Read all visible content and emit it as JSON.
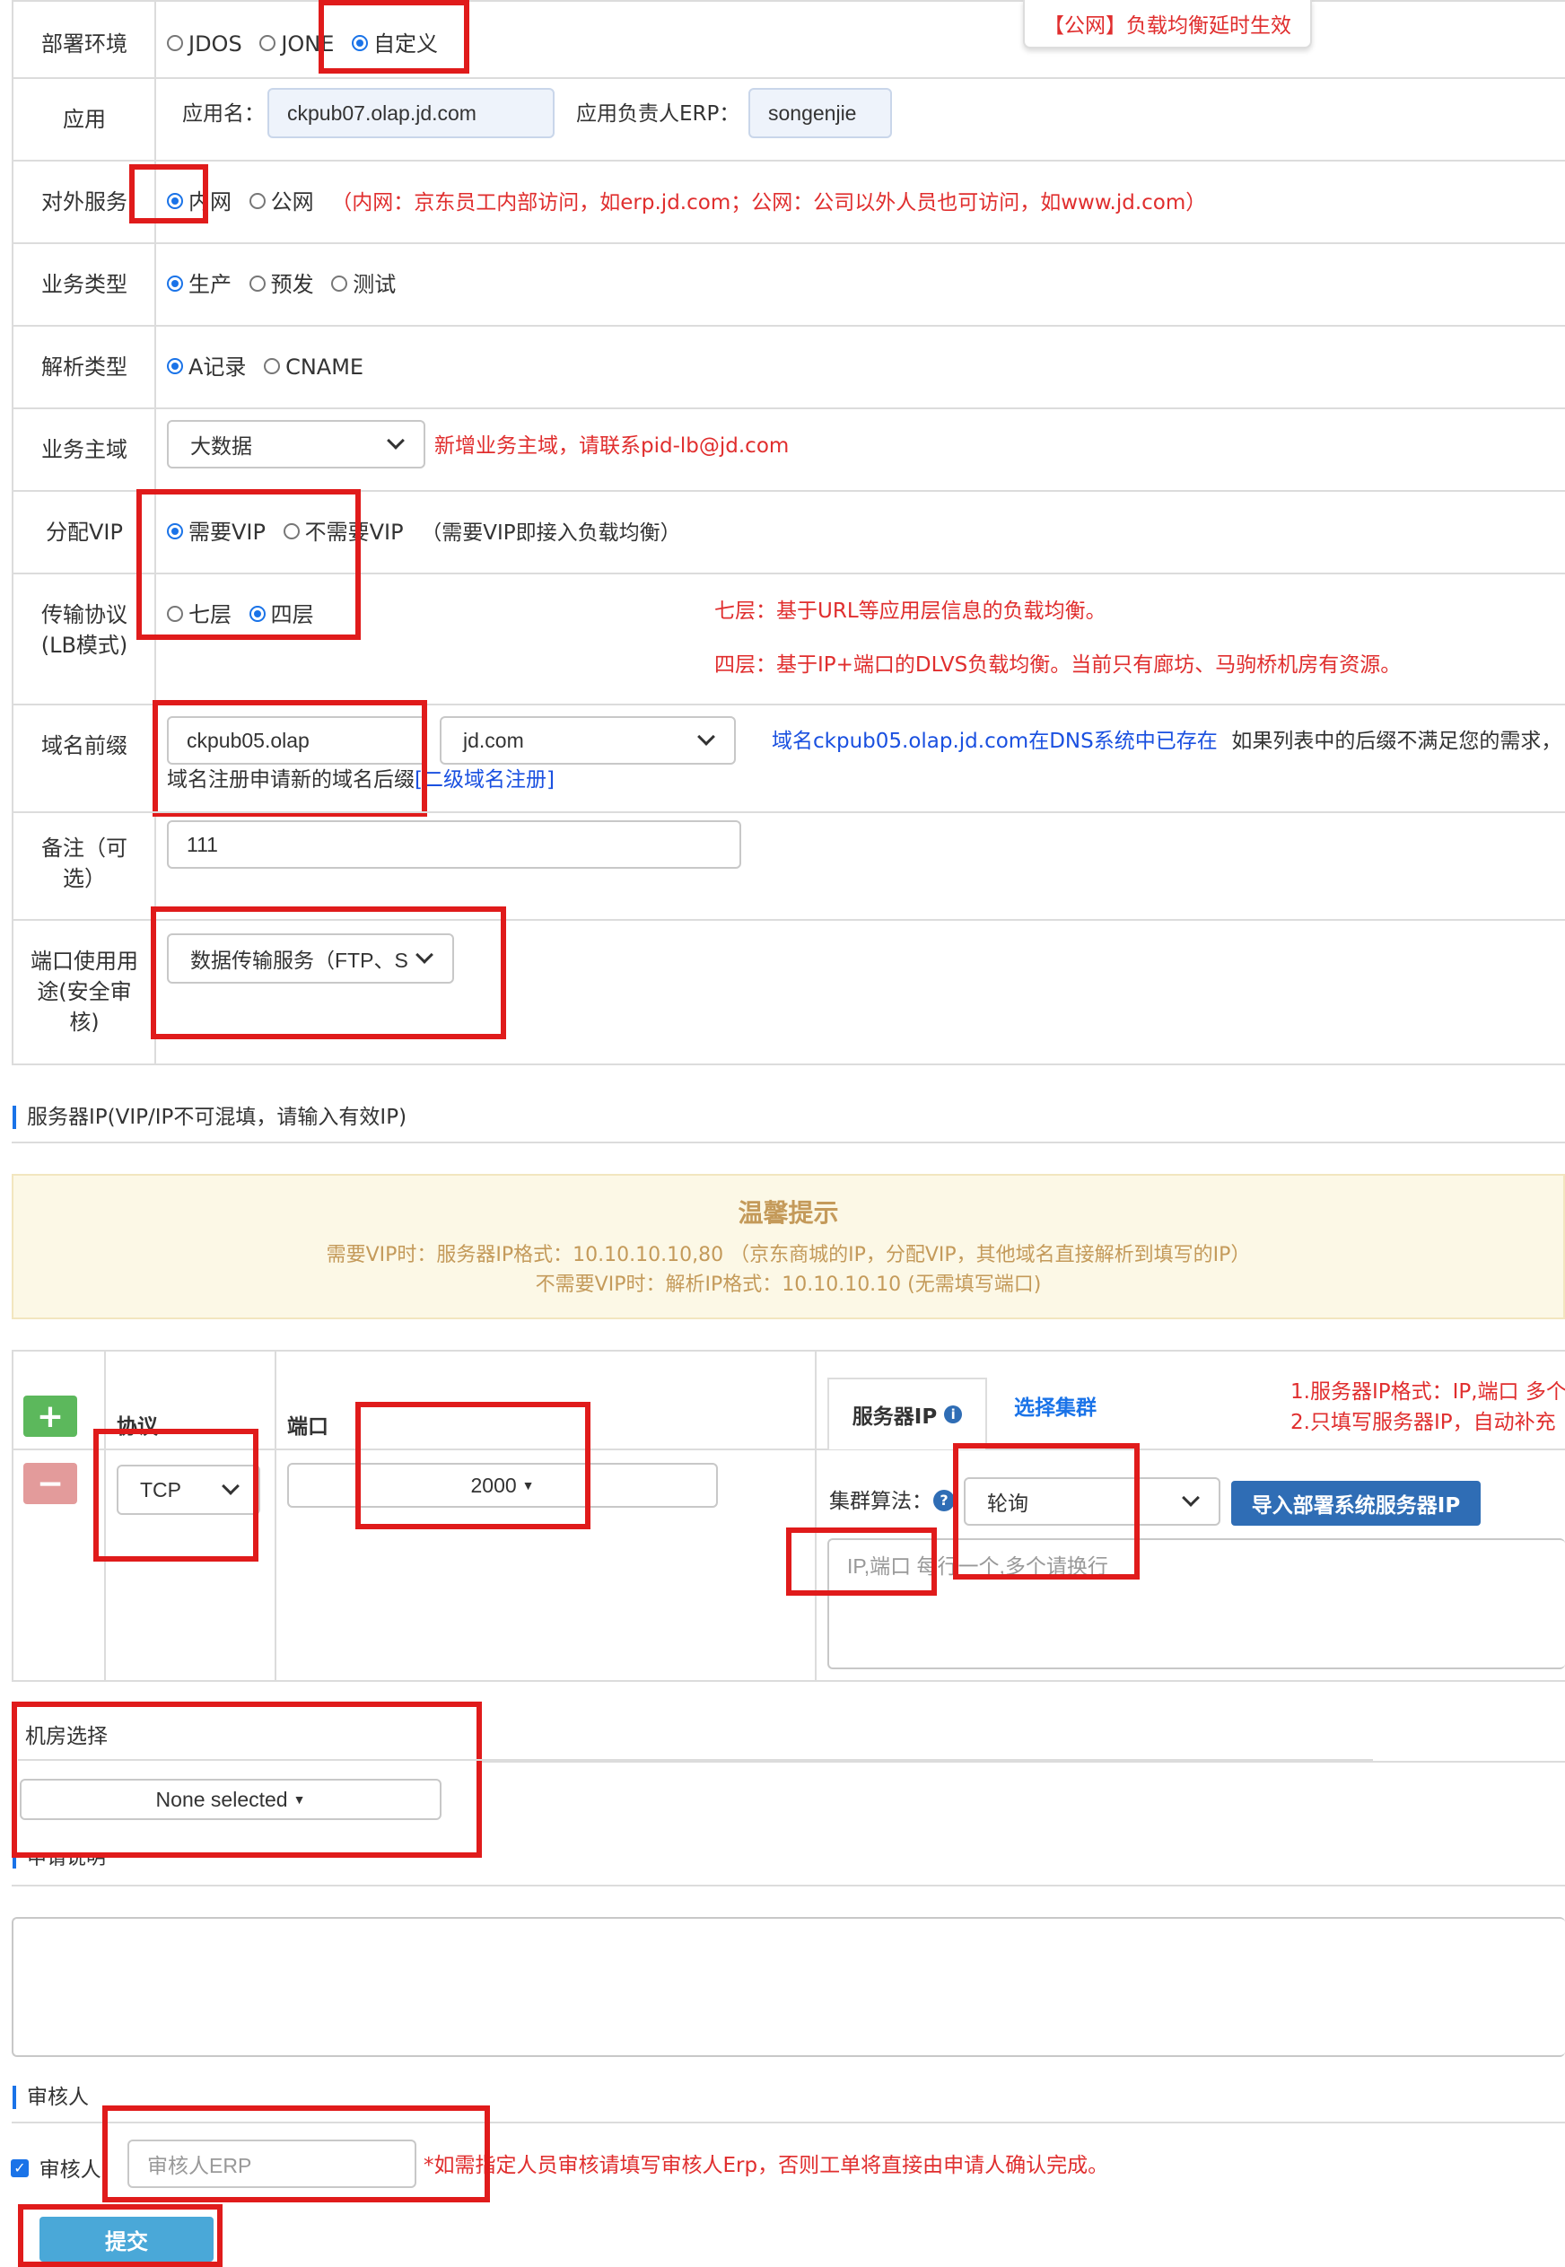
{
  "notice_tooltip": "【公网】负载均衡延时生效",
  "deploy_env": {
    "label": "部署环境",
    "options": [
      "JDOS",
      "JONE",
      "自定义"
    ],
    "selected": "自定义"
  },
  "app": {
    "label": "应用",
    "name_label": "应用名：",
    "name_value": "ckpub07.olap.jd.com",
    "owner_label": "应用负责人ERP：",
    "owner_value": "songenjie"
  },
  "external_service": {
    "label": "对外服务",
    "options": [
      "内网",
      "公网"
    ],
    "selected": "内网",
    "hint": "（内网：京东员工内部访问，如erp.jd.com；公网：公司以外人员也可访问，如www.jd.com）"
  },
  "business_type": {
    "label": "业务类型",
    "options": [
      "生产",
      "预发",
      "测试"
    ],
    "selected": "生产"
  },
  "resolve_type": {
    "label": "解析类型",
    "options": [
      "A记录",
      "CNAME"
    ],
    "selected": "A记录"
  },
  "business_domain": {
    "label": "业务主域",
    "selected": "大数据",
    "hint": "新增业务主域，请联系pid-lb@jd.com"
  },
  "assign_vip": {
    "label": "分配VIP",
    "options": [
      "需要VIP",
      "不需要VIP"
    ],
    "selected": "需要VIP",
    "note": "（需要VIP即接入负载均衡）"
  },
  "transport_protocol": {
    "label_line1": "传输协议",
    "label_line2": "(LB模式)",
    "options": [
      "七层",
      "四层"
    ],
    "selected": "四层",
    "hint_l7": "七层：基于URL等应用层信息的负载均衡。",
    "hint_l4": "四层：基于IP+端口的DLVS负载均衡。当前只有廊坊、马驹桥机房有资源。"
  },
  "domain_prefix": {
    "label": "域名前缀",
    "prefix_value": "ckpub05.olap",
    "suffix_value": "jd.com",
    "exists_msg": "域名ckpub05.olap.jd.com在DNS系统中已存在",
    "suffix_hint": "如果列表中的后缀不满足您的需求，",
    "register_text": "域名注册申请新的域名后缀",
    "register_link": "[二级域名注册]"
  },
  "remark": {
    "label_line1": "备注（可",
    "label_line2": "选）",
    "value": "111"
  },
  "port_usage": {
    "label_line1": "端口使用用",
    "label_line2": "途(安全审",
    "label_line3": "核)",
    "selected": "数据传输服务（FTP、S"
  },
  "server_ip_section": "服务器IP(VIP/IP不可混填，请输入有效IP)",
  "tips": {
    "title": "温馨提示",
    "line1": "需要VIP时：服务器IP格式：10.10.10.10,80 （京东商城的IP，分配VIP，其他域名直接解析到填写的IP）",
    "line2": "不需要VIP时：解析IP格式：10.10.10.10 (无需填写端口)"
  },
  "server_table": {
    "protocol_header": "协议",
    "port_header": "端口",
    "protocol_value": "TCP",
    "port_value": "2000",
    "tab_server_ip": "服务器IP",
    "tab_select_cluster": "选择集群",
    "note1": "1.服务器IP格式：IP,端口 多个",
    "note2": "2.只填写服务器IP，自动补充",
    "algo_label": "集群算法：",
    "algo_value": "轮询",
    "import_button": "导入部署系统服务器IP",
    "ip_placeholder": "IP,端口 每行一个,多个请换行"
  },
  "datacenter": {
    "label": "机房选择",
    "value": "None selected"
  },
  "apply_desc_section": "申请说明",
  "reviewer_section": "审核人",
  "reviewer": {
    "checkbox_label": "审核人",
    "placeholder": "审核人ERP",
    "hint": "*如需指定人员审核请填写审核人Erp，否则工单将直接由申请人确认完成。"
  },
  "submit_label": "提交",
  "colors": {
    "accent": "#1a73e8",
    "error_red": "#e02e2e",
    "highlight_box": "#e01b1b",
    "tips_bg": "#fcf8e6",
    "tips_text": "#c49a5a",
    "add_green": "#5cb85c",
    "remove_red": "#e39b9b",
    "import_btn": "#2f6db5",
    "submit_btn": "#4aa8d8"
  }
}
